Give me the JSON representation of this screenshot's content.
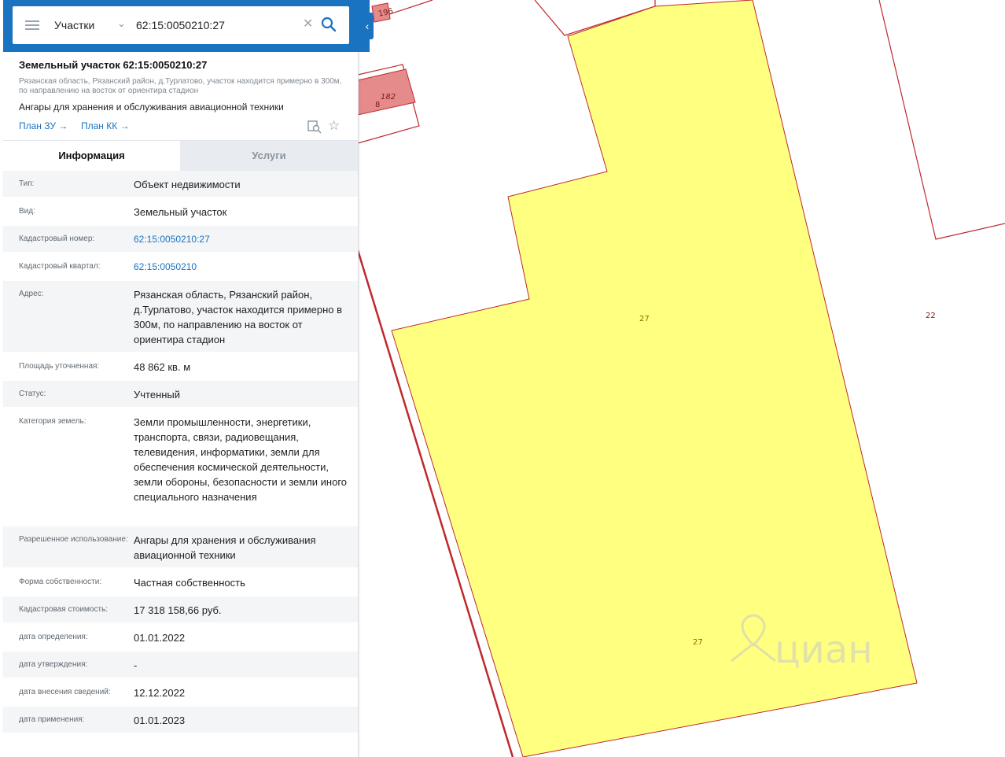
{
  "search": {
    "type_label": "Участки",
    "query": "62:15:0050210:27",
    "icons": {
      "menu": "menu-icon",
      "dropdown": "chevron-down-icon",
      "clear": "close-icon",
      "search": "search-icon",
      "collapse": "chevron-left-icon"
    }
  },
  "parcel": {
    "title": "Земельный участок 62:15:0050210:27",
    "address_short": "Рязанская область, Рязанский район, д.Турлатово, участок находится примерно в 300м, по направлению на восток от ориентира стадион",
    "purpose": "Ангары для хранения и обслуживания авиационной техники",
    "links": {
      "plan_zu": "План ЗУ →",
      "plan_kk": "План КК →"
    },
    "icons": {
      "map_search": "map-search-icon",
      "favorite": "star-icon"
    }
  },
  "tabs": {
    "info": "Информация",
    "services": "Услуги"
  },
  "info_rows": [
    {
      "label": "Тип:",
      "value": "Объект недвижимости"
    },
    {
      "label": "Вид:",
      "value": "Земельный участок"
    },
    {
      "label": "Кадастровый номер:",
      "value": "62:15:0050210:27",
      "link": true
    },
    {
      "label": "Кадастровый квартал:",
      "value": "62:15:0050210",
      "link": true
    },
    {
      "label": "Адрес:",
      "value": "Рязанская область, Рязанский район, д.Турлатово, участок находится примерно в 300м, по направлению на восток от ориентира стадион"
    },
    {
      "label": "Площадь уточненная:",
      "value": "48 862 кв. м"
    },
    {
      "label": "Статус:",
      "value": "Учтенный"
    },
    {
      "label": "Категория земель:",
      "value": "Земли промышленности, энергетики, транспорта, связи, радиовещания, телевидения, информатики, земли для обеспечения космической деятельности, земли обороны, безопасности и земли иного специального назначения"
    },
    {
      "label": "Разрешенное использование:",
      "value": "Ангары для хранения и обслуживания авиационной техники"
    },
    {
      "label": "Форма собственности:",
      "value": "Частная собственность"
    },
    {
      "label": "Кадастровая стоимость:",
      "value": "17 318 158,66 руб."
    },
    {
      "label": "дата определения:",
      "value": "01.01.2022"
    },
    {
      "label": "дата утверждения:",
      "value": "-"
    },
    {
      "label": "дата внесения сведений:",
      "value": "12.12.2022"
    },
    {
      "label": "дата применения:",
      "value": "01.01.2023"
    }
  ],
  "map": {
    "parcel_labels": [
      "196",
      "182",
      "8",
      "27",
      "27",
      "22"
    ],
    "watermark": "циан",
    "colors": {
      "selected_parcel": "#ffff80",
      "parcel_border": "#c0282d",
      "building": "#e58b8b"
    }
  }
}
